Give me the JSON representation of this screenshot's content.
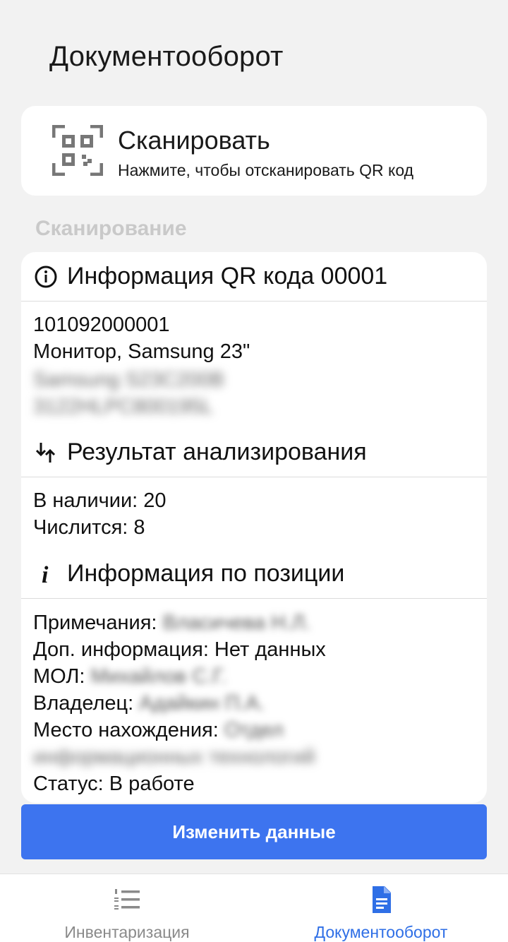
{
  "header": {
    "title": "Документооборот"
  },
  "scan_card": {
    "title": "Сканировать",
    "subtitle": "Нажмите, чтобы отсканировать QR код",
    "icon": "qr-code-icon"
  },
  "section": {
    "label": "Сканирование"
  },
  "qr_info": {
    "title": "Информация QR кода 00001",
    "icon": "info-circle-icon",
    "code": "101092000001",
    "name": "Монитор, Samsung 23\"",
    "model_line1": "Samsung S23C200B",
    "model_line2": "3122HLPC800195L"
  },
  "analysis": {
    "title": "Результат анализирования",
    "icon": "sort-arrows-icon",
    "available": "В наличии: 20",
    "listed": "Числится: 8"
  },
  "position": {
    "title": "Информация по позиции",
    "icon": "italic-i-icon",
    "notes_label": "Примечания:",
    "notes_value": "Власичева Н.Л.",
    "extra_info": "Доп. информация: Нет данных",
    "mol_label": "МОЛ:",
    "mol_value": "Михайлов С.Г.",
    "owner_label": "Владелец:",
    "owner_value": "Адайкин П.А.",
    "location_label": "Место нахождения:",
    "location_value_1": "Отдел",
    "location_value_2": "информационных технологий",
    "status": "Статус: В работе"
  },
  "actions": {
    "edit_label": "Изменить данные",
    "edit_color": "#3d74ef"
  },
  "bottom_nav": {
    "items": [
      {
        "label": "Инвентаризация",
        "icon": "numbered-list-icon",
        "active": false
      },
      {
        "label": "Документооборот",
        "icon": "document-icon",
        "active": true
      }
    ],
    "active_color": "#2f6fe6"
  }
}
